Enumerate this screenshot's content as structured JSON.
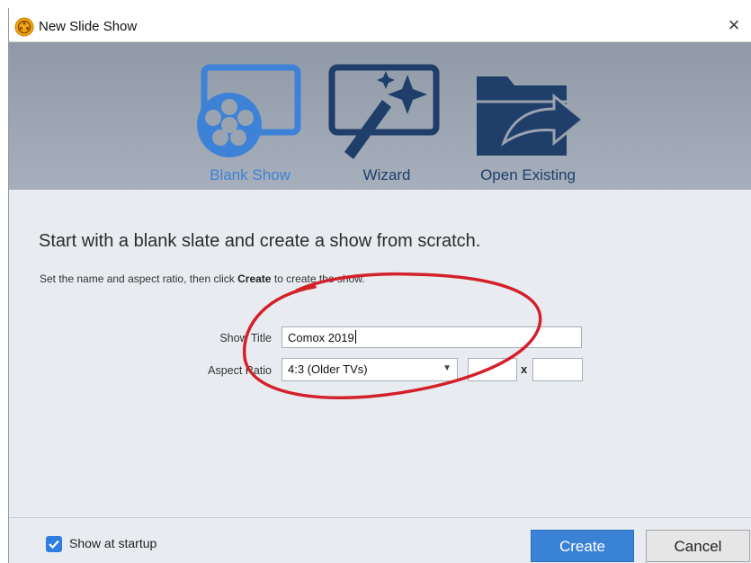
{
  "window": {
    "title": "New Slide Show",
    "close_glyph": "×"
  },
  "modes": [
    {
      "label": "Blank Show",
      "icon": "blank-show-icon",
      "active": true
    },
    {
      "label": "Wizard",
      "icon": "wizard-wand-icon",
      "active": false
    },
    {
      "label": "Open Existing",
      "icon": "open-folder-icon",
      "active": false
    }
  ],
  "content": {
    "headline": "Start with a blank slate and create a show from scratch.",
    "instruction_prefix": "Set the name and aspect ratio, then click ",
    "instruction_bold": "Create",
    "instruction_suffix": " to create the show."
  },
  "form": {
    "show_title_label": "Show Title",
    "show_title_value": "Comox 2019",
    "aspect_ratio_label": "Aspect Ratio",
    "aspect_ratio_selected": "4:3 (Older TVs)",
    "custom_width": "",
    "custom_height": "",
    "separator": "x"
  },
  "footer": {
    "show_at_startup_label": "Show at startup",
    "show_at_startup_checked": true,
    "create_label": "Create",
    "cancel_label": "Cancel"
  },
  "colors": {
    "accent": "#3a82d6",
    "icon_dark": "#1f3e6a",
    "header_bg": "#9aa3b0",
    "annotation": "#d4202a"
  }
}
